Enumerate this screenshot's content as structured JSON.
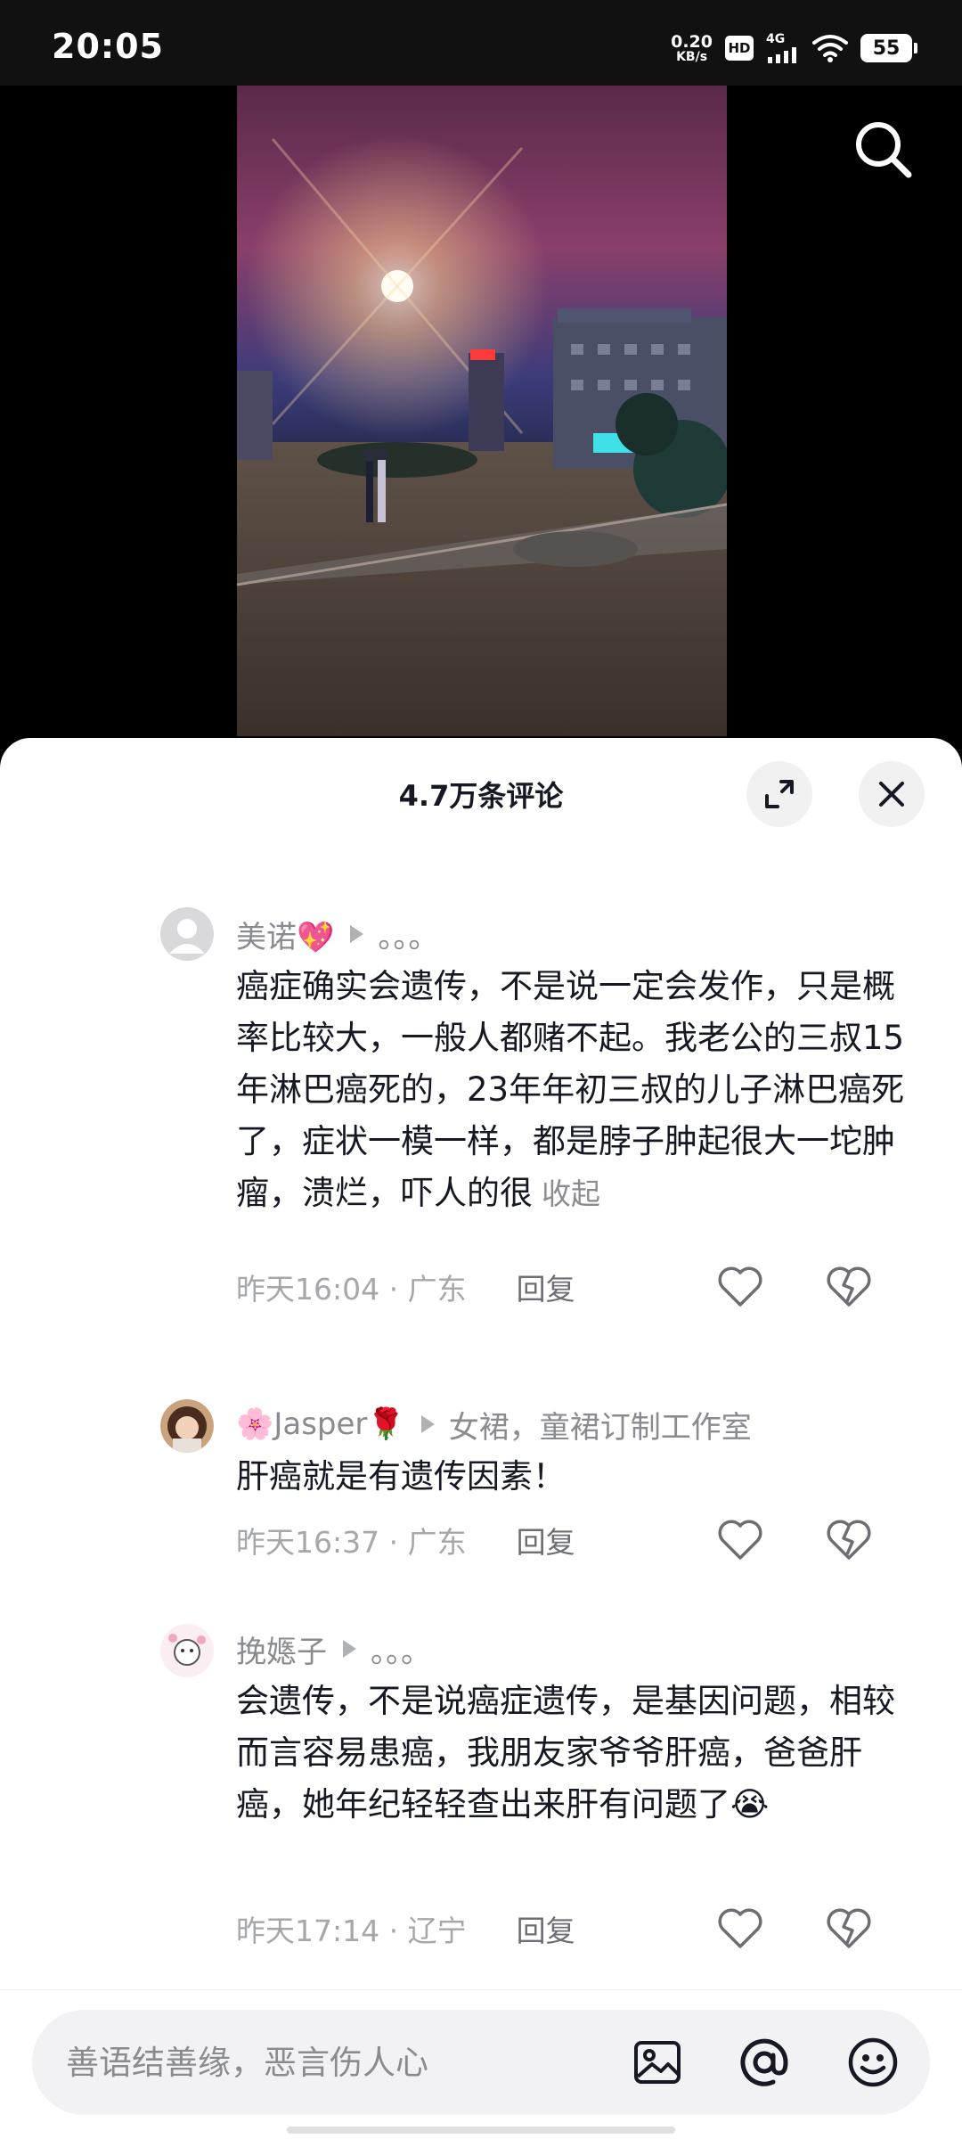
{
  "status_bar": {
    "time": "20:05",
    "net_speed_value": "0.20",
    "net_speed_unit": "KB/s",
    "hd_label": "HD",
    "network_type": "4G",
    "battery_level": "55"
  },
  "sheet": {
    "title": "4.7万条评论"
  },
  "comments": [
    {
      "username": "美诺💖",
      "reply_to": "。。。",
      "text": "癌症确实会遗传，不是说一定会发作，只是概率比较大，一般人都赌不起。我老公的三叔15年淋巴癌死的，23年年初三叔的儿子淋巴癌死了，症状一模一样，都是脖子肿起很大一坨肿瘤，溃烂，吓人的很",
      "collapse_label": "收起",
      "time_location": "昨天16:04 · 广东",
      "reply_label": "回复"
    },
    {
      "username": "🌸Jasper🌹",
      "reply_to": "女裙，童裙订制工作室",
      "text": "肝癌就是有遗传因素！",
      "time_location": "昨天16:37 · 广东",
      "reply_label": "回复"
    },
    {
      "username": "挽嫕子",
      "reply_to": "。。。",
      "text": "会遗传，不是说癌症遗传，是基因问题，相较而言容易患癌，我朋友家爷爷肝癌，爸爸肝癌，她年纪轻轻查出来肝有问题了😭",
      "time_location": "昨天17:14 · 辽宁",
      "reply_label": "回复"
    }
  ],
  "input": {
    "placeholder": "善语结善缘，恶言伤人心"
  },
  "icons": {
    "search": "search-icon",
    "expand": "expand-icon",
    "close": "close-icon",
    "like": "heart-icon",
    "dislike": "broken-heart-icon",
    "image": "image-icon",
    "mention": "at-icon",
    "emoji": "emoji-icon"
  }
}
